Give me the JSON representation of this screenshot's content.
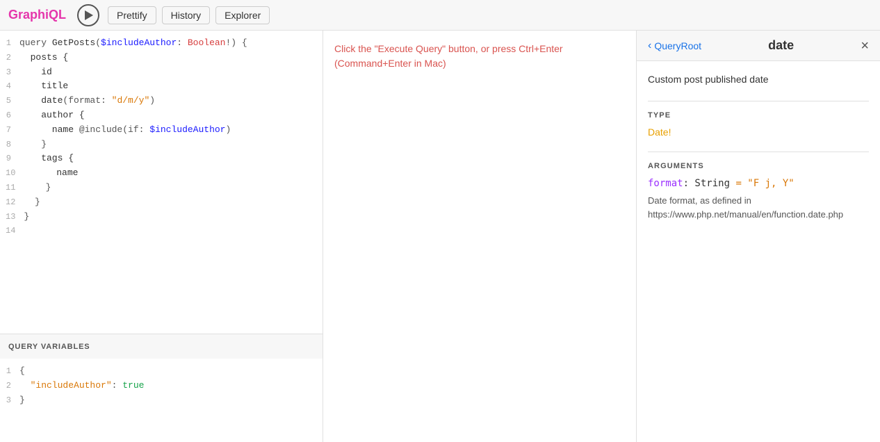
{
  "header": {
    "logo": "GraphiQL",
    "run_label": "▶",
    "prettify_label": "Prettify",
    "history_label": "History",
    "explorer_label": "Explorer"
  },
  "editor": {
    "lines": [
      {
        "num": 1,
        "tokens": [
          {
            "text": "query ",
            "class": "kw-keyword"
          },
          {
            "text": "GetPosts",
            "class": "kw-name"
          },
          {
            "text": "(",
            "class": "kw-punct"
          },
          {
            "text": "$includeAuthor",
            "class": "kw-var"
          },
          {
            "text": ": ",
            "class": "kw-punct"
          },
          {
            "text": "Boolean",
            "class": "kw-type"
          },
          {
            "text": "!) {",
            "class": "kw-punct"
          }
        ]
      },
      {
        "num": 2,
        "tokens": [
          {
            "text": "  posts {",
            "class": "kw-field"
          }
        ]
      },
      {
        "num": 3,
        "tokens": [
          {
            "text": "    id",
            "class": "kw-field"
          }
        ]
      },
      {
        "num": 4,
        "tokens": [
          {
            "text": "    title",
            "class": "kw-field"
          }
        ]
      },
      {
        "num": 5,
        "tokens": [
          {
            "text": "    date",
            "class": "kw-field"
          },
          {
            "text": "(format: ",
            "class": "kw-punct"
          },
          {
            "text": "\"d/m/y\"",
            "class": "kw-string"
          },
          {
            "text": ")",
            "class": "kw-punct"
          }
        ]
      },
      {
        "num": 6,
        "tokens": [
          {
            "text": "    author {",
            "class": "kw-field"
          }
        ]
      },
      {
        "num": 7,
        "tokens": [
          {
            "text": "      name ",
            "class": "kw-field"
          },
          {
            "text": "@include",
            "class": "kw-directive"
          },
          {
            "text": "(if: ",
            "class": "kw-punct"
          },
          {
            "text": "$includeAuthor",
            "class": "kw-var"
          },
          {
            "text": ")",
            "class": "kw-punct"
          }
        ]
      },
      {
        "num": 8,
        "tokens": [
          {
            "text": "    }",
            "class": "kw-punct"
          }
        ]
      },
      {
        "num": 9,
        "tokens": [
          {
            "text": "    tags {",
            "class": "kw-field"
          }
        ]
      },
      {
        "num": 10,
        "tokens": [
          {
            "text": "      name",
            "class": "kw-field"
          }
        ]
      },
      {
        "num": 11,
        "tokens": [
          {
            "text": "    }",
            "class": "kw-punct"
          }
        ]
      },
      {
        "num": 12,
        "tokens": [
          {
            "text": "  }",
            "class": "kw-punct"
          }
        ]
      },
      {
        "num": 13,
        "tokens": [
          {
            "text": "}",
            "class": "kw-punct"
          }
        ]
      },
      {
        "num": 14,
        "tokens": [
          {
            "text": "",
            "class": ""
          }
        ]
      }
    ]
  },
  "query_vars": {
    "header": "QUERY VARIABLES",
    "lines": [
      {
        "num": 1,
        "tokens": [
          {
            "text": "{",
            "class": "kw-punct"
          }
        ]
      },
      {
        "num": 2,
        "tokens": [
          {
            "text": "  \"includeAuthor\"",
            "class": "kw-string"
          },
          {
            "text": ": ",
            "class": "kw-punct"
          },
          {
            "text": "true",
            "class": "kw-bool"
          }
        ]
      },
      {
        "num": 3,
        "tokens": [
          {
            "text": "}",
            "class": "kw-punct"
          }
        ]
      }
    ]
  },
  "result": {
    "hint": "Click the \"Execute Query\" button, or press Ctrl+Enter\n(Command+Enter in Mac)"
  },
  "docs": {
    "back_label": "QueryRoot",
    "title": "date",
    "close_symbol": "×",
    "description": "Custom post published date",
    "type_section": "TYPE",
    "type_value": "Date!",
    "arguments_section": "ARGUMENTS",
    "arg_name": "format",
    "arg_type": ": String",
    "arg_default": " = \"F j, Y\"",
    "arg_description": "Date format, as defined in https://www.php.net/manual/en/function.date.php"
  }
}
